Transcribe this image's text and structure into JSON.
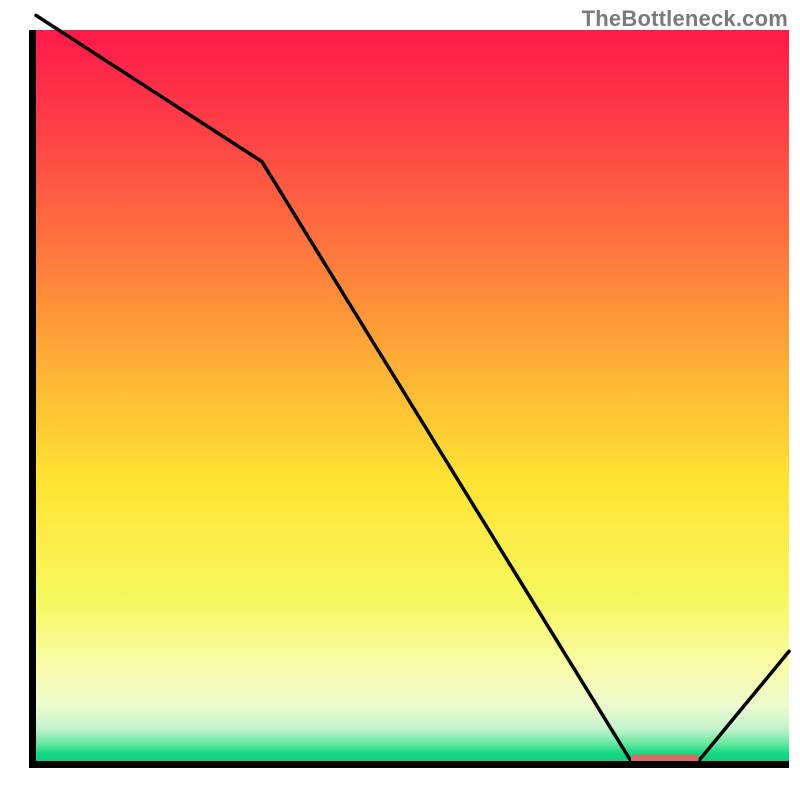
{
  "attribution": "TheBottleneck.com",
  "chart_data": {
    "type": "line",
    "title": "",
    "xlabel": "",
    "ylabel": "",
    "x": [
      0.0,
      0.3,
      0.79,
      0.88,
      1.0
    ],
    "y": [
      1.02,
      0.82,
      0.0,
      0.0,
      0.15
    ],
    "ylim": [
      0,
      1
    ],
    "xlim": [
      0,
      1
    ],
    "legend": false,
    "grid": false,
    "marker_segment": {
      "x0": 0.79,
      "x1": 0.88,
      "y": 0.002,
      "color": "#d96a6a"
    },
    "gradient_stops": [
      {
        "offset": 0.0,
        "color": "#ff1a4b"
      },
      {
        "offset": 0.12,
        "color": "#ff3b47"
      },
      {
        "offset": 0.3,
        "color": "#ff763e"
      },
      {
        "offset": 0.48,
        "color": "#ffb735"
      },
      {
        "offset": 0.62,
        "color": "#ffe433"
      },
      {
        "offset": 0.78,
        "color": "#f6f85f"
      },
      {
        "offset": 0.88,
        "color": "#f9fcb0"
      },
      {
        "offset": 0.925,
        "color": "#ecfbd0"
      },
      {
        "offset": 0.955,
        "color": "#c7f3cc"
      },
      {
        "offset": 0.975,
        "color": "#6de8a2"
      },
      {
        "offset": 0.99,
        "color": "#14d884"
      },
      {
        "offset": 1.0,
        "color": "#0fce7e"
      }
    ]
  }
}
